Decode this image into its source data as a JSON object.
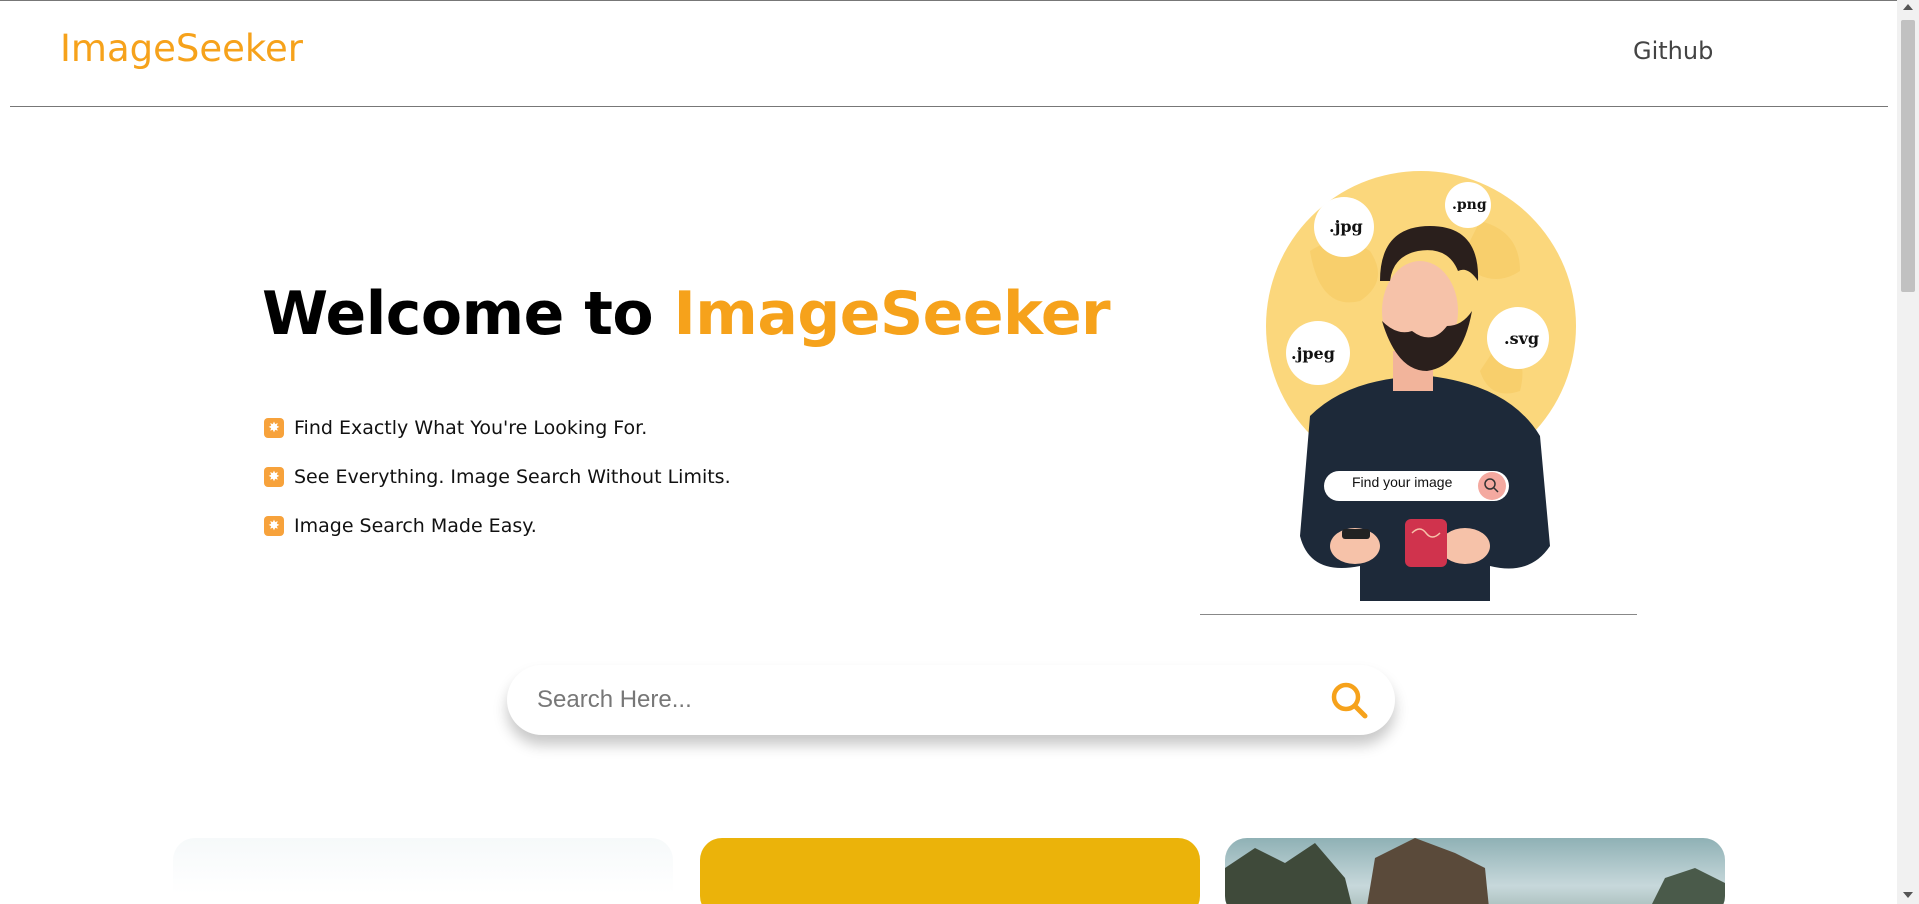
{
  "header": {
    "brand": "ImageSeeker",
    "nav_link": "Github"
  },
  "hero": {
    "title_prefix": "Welcome to",
    "title_accent": "ImageSeeker",
    "features": [
      "Find Exactly What You're Looking For.",
      "See Everything. Image Search Without Limits.",
      "Image Search Made Easy."
    ]
  },
  "illustration": {
    "tags": [
      ".jpg",
      ".png",
      ".jpeg",
      ".svg"
    ],
    "search_label": "Find your image"
  },
  "search": {
    "placeholder": "Search Here...",
    "icon": "search-icon"
  },
  "colors": {
    "accent": "#f6a21b",
    "bullet": "#f7a23b",
    "card_yellow": "#ebb30a"
  }
}
